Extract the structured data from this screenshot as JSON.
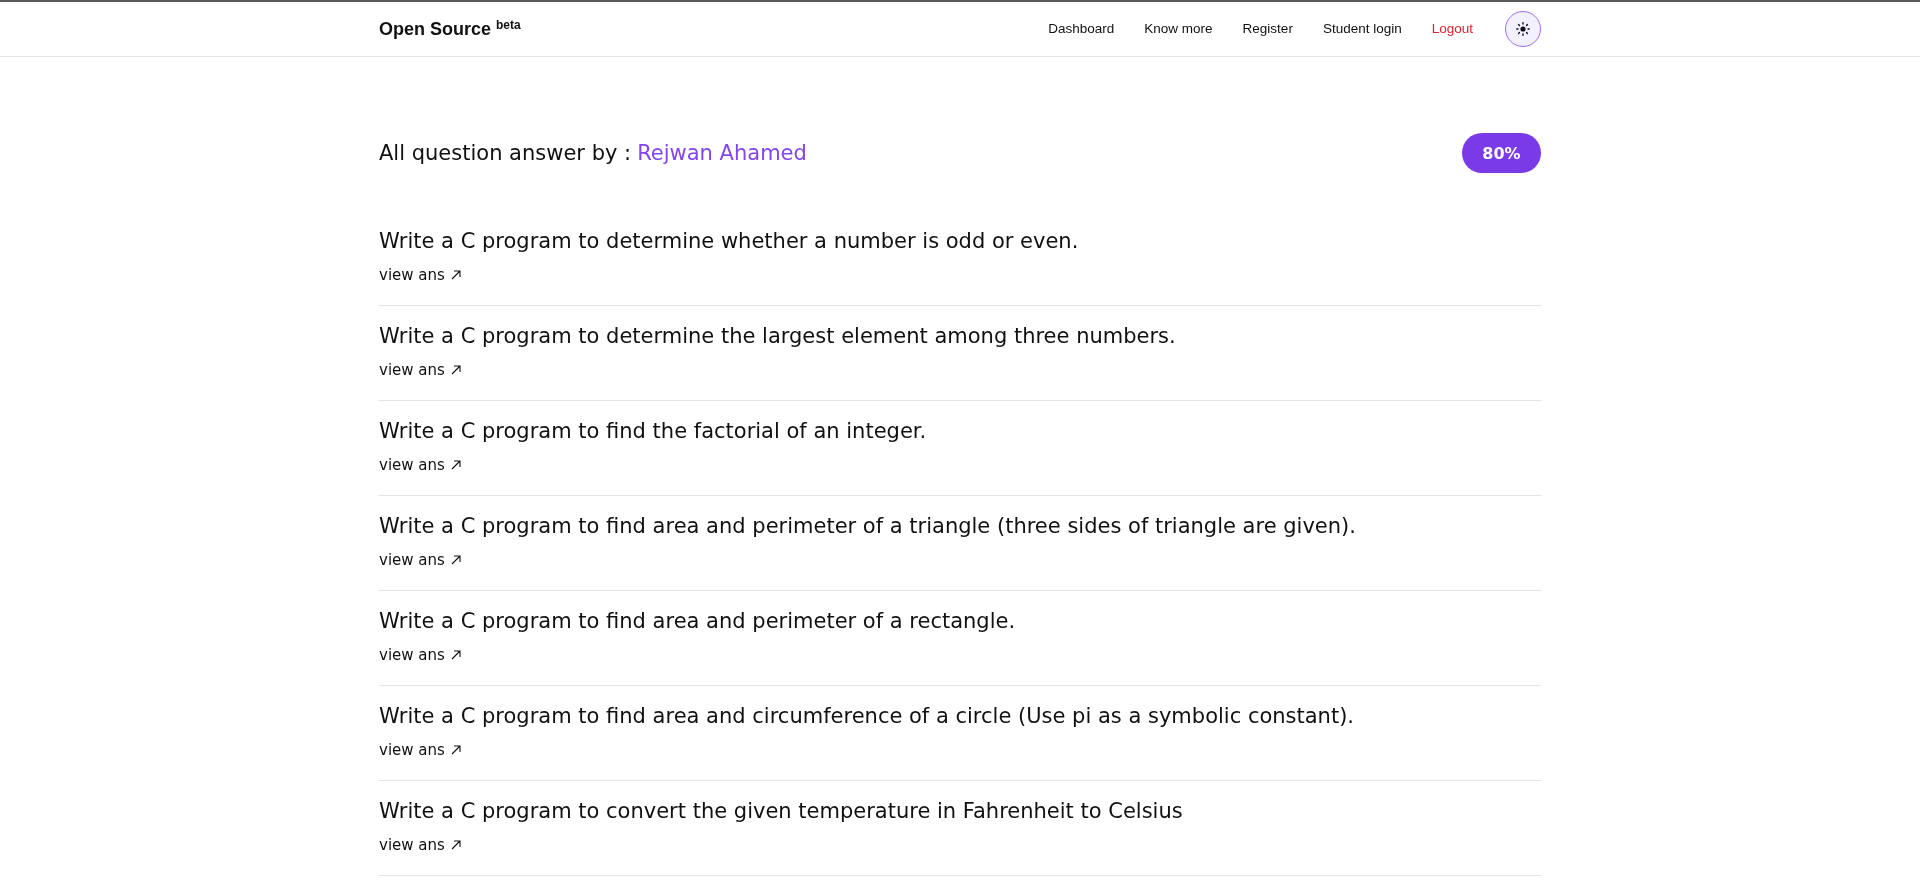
{
  "header": {
    "logo": "Open Source",
    "logo_badge": "beta",
    "nav": [
      {
        "label": "Dashboard",
        "kind": "link"
      },
      {
        "label": "Know more",
        "kind": "link"
      },
      {
        "label": "Register",
        "kind": "link"
      },
      {
        "label": "Student login",
        "kind": "link"
      },
      {
        "label": "Logout",
        "kind": "danger"
      }
    ]
  },
  "intro": {
    "label": "All question answer by :",
    "author": "Rejwan Ahamed",
    "progress_badge": "80%"
  },
  "questions": [
    {
      "text": "Write a C program to determine whether a number is odd or even.",
      "link": "view ans"
    },
    {
      "text": "Write a C program to determine the largest element among three numbers.",
      "link": "view ans"
    },
    {
      "text": "Write a C program to find the factorial of an integer.",
      "link": "view ans"
    },
    {
      "text": "Write a C program to find area and perimeter of a triangle (three sides of triangle are given).",
      "link": "view ans"
    },
    {
      "text": "Write a C program to find area and perimeter of a rectangle.",
      "link": "view ans"
    },
    {
      "text": "Write a C program to find area and circumference of a circle (Use pi as a symbolic constant).",
      "link": "view ans"
    },
    {
      "text": "Write a C program to convert the given temperature in Fahrenheit to Celsius",
      "link": "view ans"
    }
  ]
}
